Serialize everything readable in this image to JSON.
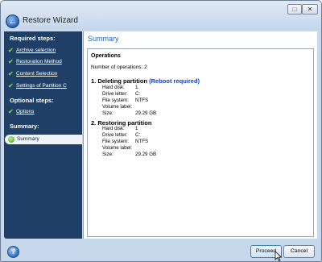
{
  "window": {
    "title": "Restore Wizard"
  },
  "sidebar": {
    "required_heading": "Required steps:",
    "required_items": [
      {
        "label": "Archive selection"
      },
      {
        "label": "Restoration Method"
      },
      {
        "label": "Content Selection"
      },
      {
        "label": "Settings of Partition C"
      }
    ],
    "optional_heading": "Optional steps:",
    "optional_items": [
      {
        "label": "Options"
      }
    ],
    "summary_heading": "Summary:",
    "summary_item": "Summary"
  },
  "main": {
    "title": "Summary",
    "operations_header": "Operations",
    "operations_count": "Number of operations: 2",
    "ops": [
      {
        "title": "1. Deleting partition",
        "note": "(Reboot required)",
        "details": [
          {
            "key": "Hard disk:",
            "value": "1"
          },
          {
            "key": "Drive letter:",
            "value": "C:"
          },
          {
            "key": "File system:",
            "value": "NTFS"
          },
          {
            "key": "Volume label:",
            "value": ""
          },
          {
            "key": "Size:",
            "value": "29.29 GB"
          }
        ]
      },
      {
        "title": "2. Restoring partition",
        "note": "",
        "details": [
          {
            "key": "Hard disk:",
            "value": "1"
          },
          {
            "key": "Drive letter:",
            "value": "C:"
          },
          {
            "key": "File system:",
            "value": "NTFS"
          },
          {
            "key": "Volume label:",
            "value": ""
          },
          {
            "key": "Size:",
            "value": "29.29 GB"
          }
        ]
      }
    ]
  },
  "footer": {
    "proceed": "Proceed",
    "cancel": "Cancel"
  }
}
